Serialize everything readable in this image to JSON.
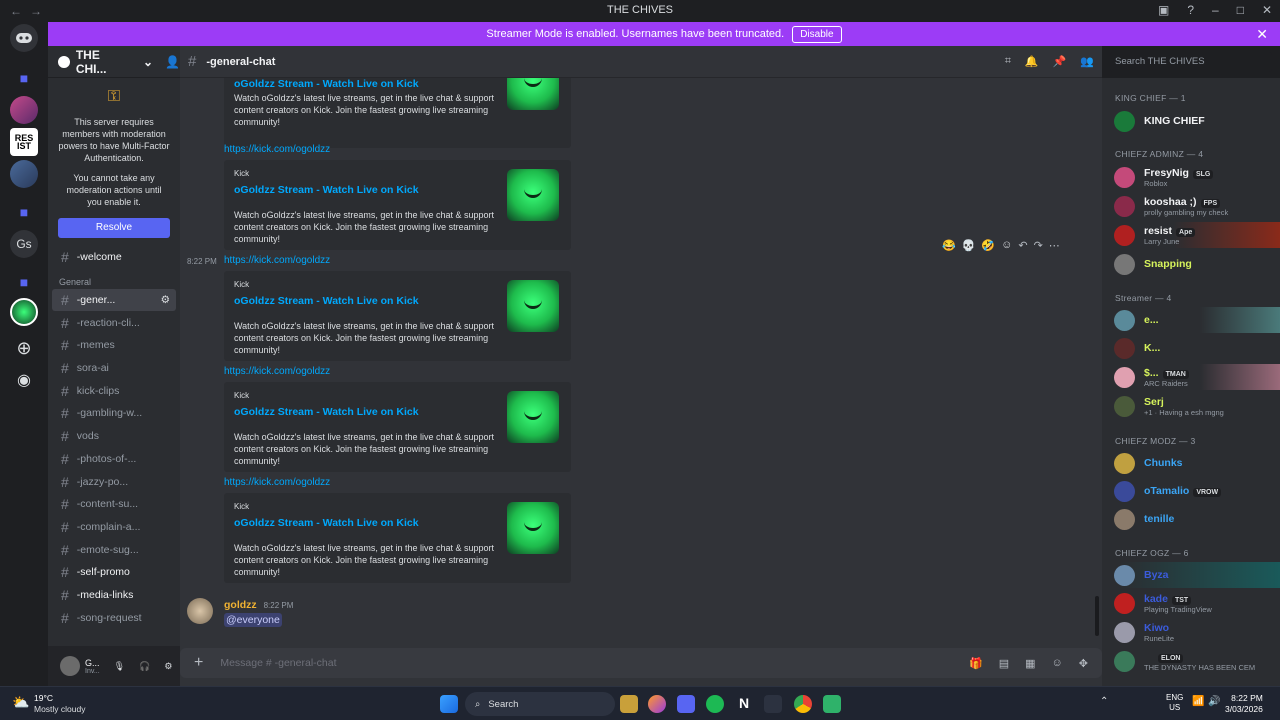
{
  "window": {
    "title": "THE CHIVES"
  },
  "banner": {
    "text": "Streamer Mode is enabled. Usernames have been truncated.",
    "disable": "Disable"
  },
  "guilds": {
    "resist": "RES IST",
    "gs": "Gs"
  },
  "server": {
    "name": "THE CHI...",
    "mfa_text": "This server requires members with moderation powers to have Multi-Factor Authentication.",
    "mfa_text2": "You cannot take any moderation actions until you enable it.",
    "resolve": "Resolve"
  },
  "channels": {
    "welcome": "-welcome",
    "category_general": "General",
    "items": [
      "-gener...",
      "-reaction-cli...",
      "-memes",
      "sora-ai",
      "kick-clips",
      "-gambling-w...",
      "vods",
      "-photos-of-...",
      "-jazzy-po...",
      "-content-su...",
      "-complain-a...",
      "-emote-sug...",
      "-self-promo",
      "-media-links",
      "-song-request"
    ]
  },
  "user": {
    "name": "G...",
    "status": "Inv..."
  },
  "chat": {
    "channel": "-general-chat",
    "link": "https://kick.com/ogoldzz",
    "provider": "Kick",
    "embed_title": "oGoldzz Stream - Watch Live on Kick",
    "embed_desc": "Watch oGoldzz's latest live streams, get in the live chat & support content creators on Kick. Join the fastest growing live streaming community!",
    "time": "8:22 PM",
    "author": "goldzz",
    "author_time": "8:22 PM",
    "mention": "@everyone",
    "placeholder": "Message # -general-chat"
  },
  "search": {
    "placeholder": "Search THE CHIVES"
  },
  "members": {
    "king_head": "KING CHIEF — 1",
    "king": "KING CHIEF",
    "adminz_head": "CHIEFZ ADMINZ — 4",
    "fresy": "FresyNig",
    "fresy_tag": "SLG",
    "fresy_st": "Roblox",
    "kooshaa": "kooshaa ;)",
    "kooshaa_tag": "FPS",
    "kooshaa_st": "prolly gambling my check",
    "resist": "resist",
    "resist_tag": "Ape",
    "resist_st": "Larry June",
    "snapping": "Snapping",
    "streamer_head": "Streamer — 4",
    "s1": "e...",
    "s2": "K...",
    "s3": "$...",
    "s3_tag": "TMAN",
    "s3_st": "ARC Raiders",
    "s4": "Serj",
    "s4_st": "+1 · Having a esh mgng",
    "modz_head": "CHIEFZ MODZ — 3",
    "chunks": "Chunks",
    "otamalio": "oTamalio",
    "otamalio_tag": "VROW",
    "tenille": "tenille",
    "ogz_head": "CHIEFZ OGZ — 6",
    "byza": "Byza",
    "kade": "kade",
    "kade_tag": "TST",
    "kade_st": "Playing TradingView",
    "kiwo": "Kiwo",
    "kiwo_st": "RuneLite",
    "last_tag": "ELON",
    "last_st": "THE DYNASTY HAS BEEN CEM"
  },
  "taskbar": {
    "weather_temp": "19°C",
    "weather_desc": "Mostly cloudy",
    "search": "Search",
    "lang1": "ENG",
    "lang2": "US",
    "time": "8:22 PM",
    "date": "3/03/2026"
  }
}
